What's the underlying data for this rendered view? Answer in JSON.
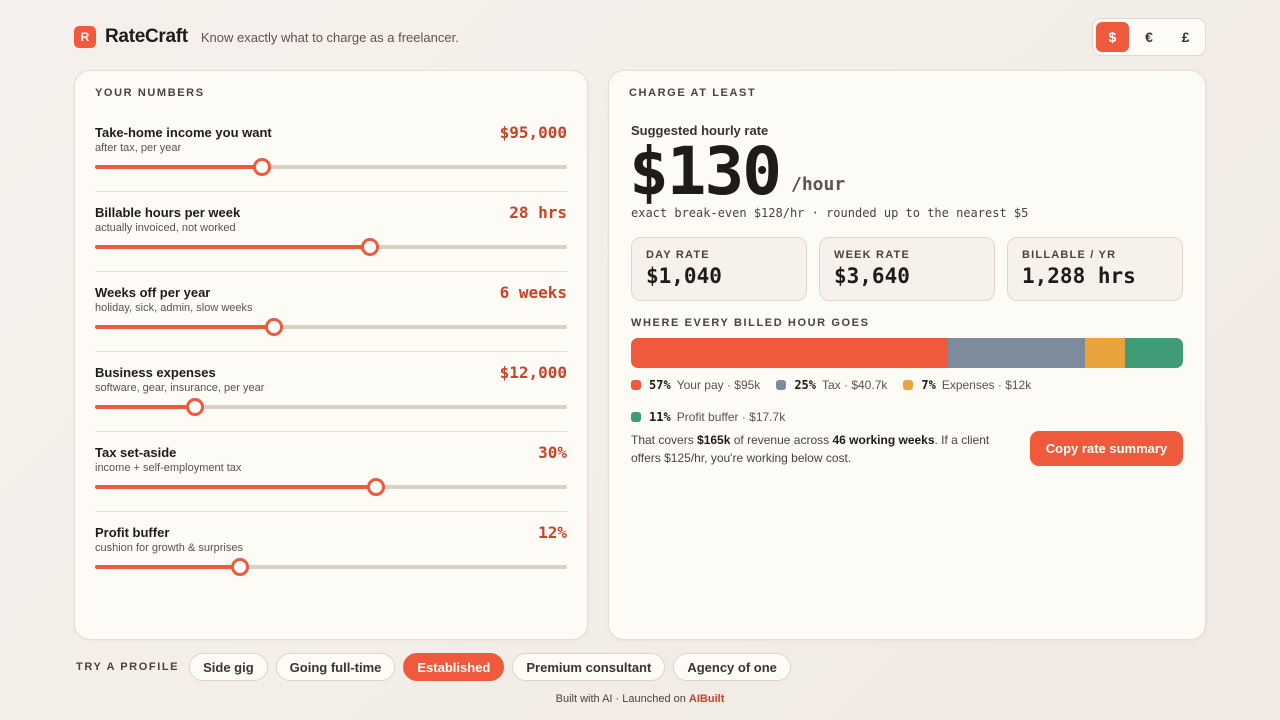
{
  "header": {
    "logo_letter": "R",
    "app_name": "RateCraft",
    "tagline": "Know exactly what to charge as a freelancer."
  },
  "currency": {
    "options": [
      "$",
      "€",
      "£"
    ],
    "selected": "$"
  },
  "inputs": {
    "title": "YOUR NUMBERS",
    "rows": [
      {
        "label": "Take-home income you want",
        "sub": "after tax, per year",
        "value": "$95,000",
        "level": 0.354
      },
      {
        "label": "Billable hours per week",
        "sub": "actually invoiced, not worked",
        "value": "28 hrs",
        "level": 0.582
      },
      {
        "label": "Weeks off per year",
        "sub": "holiday, sick, admin, slow weeks",
        "value": "6 weeks",
        "level": 0.379
      },
      {
        "label": "Business expenses",
        "sub": "software, gear, insurance, per year",
        "value": "$12,000",
        "level": 0.212
      },
      {
        "label": "Tax set-aside",
        "sub": "income + self-employment tax",
        "value": "30%",
        "level": 0.595
      },
      {
        "label": "Profit buffer",
        "sub": "cushion for growth & surprises",
        "value": "12%",
        "level": 0.307
      }
    ]
  },
  "result": {
    "title": "CHARGE AT LEAST",
    "rate_label": "Suggested hourly rate",
    "rate": "$130",
    "rate_unit": "/hour",
    "note": "exact break-even $128/hr · rounded up to the nearest $5",
    "stats": [
      {
        "label": "DAY RATE",
        "value": "$1,040"
      },
      {
        "label": "WEEK RATE",
        "value": "$3,640"
      },
      {
        "label": "BILLABLE / YR",
        "value": "1,288 hrs"
      }
    ],
    "breakdown_title": "WHERE EVERY BILLED HOUR GOES",
    "breakdown": [
      {
        "pct": "57%",
        "label": "Your pay · $95k",
        "share": 57.5,
        "color": "#ef5a3c"
      },
      {
        "pct": "25%",
        "label": "Tax · $40.7k",
        "share": 24.7,
        "color": "#7d8b9c"
      },
      {
        "pct": "7%",
        "label": "Expenses · $12k",
        "share": 7.3,
        "color": "#e9a33d"
      },
      {
        "pct": "11%",
        "label": "Profit buffer · $17.7k",
        "share": 10.5,
        "color": "#3f9c76"
      }
    ],
    "summary": {
      "p1": "That covers ",
      "revenue": "$165k",
      "p2": " of revenue across ",
      "weeks": "46 working weeks",
      "p3": ". If a client offers $125/hr, you're working below cost."
    },
    "copy_button": "Copy rate summary"
  },
  "profiles": {
    "label": "TRY A PROFILE",
    "items": [
      "Side gig",
      "Going full-time",
      "Established",
      "Premium consultant",
      "Agency of one"
    ],
    "active": "Established"
  },
  "footer": {
    "text": "Built with AI · Launched on ",
    "brand": "AIBuilt"
  }
}
